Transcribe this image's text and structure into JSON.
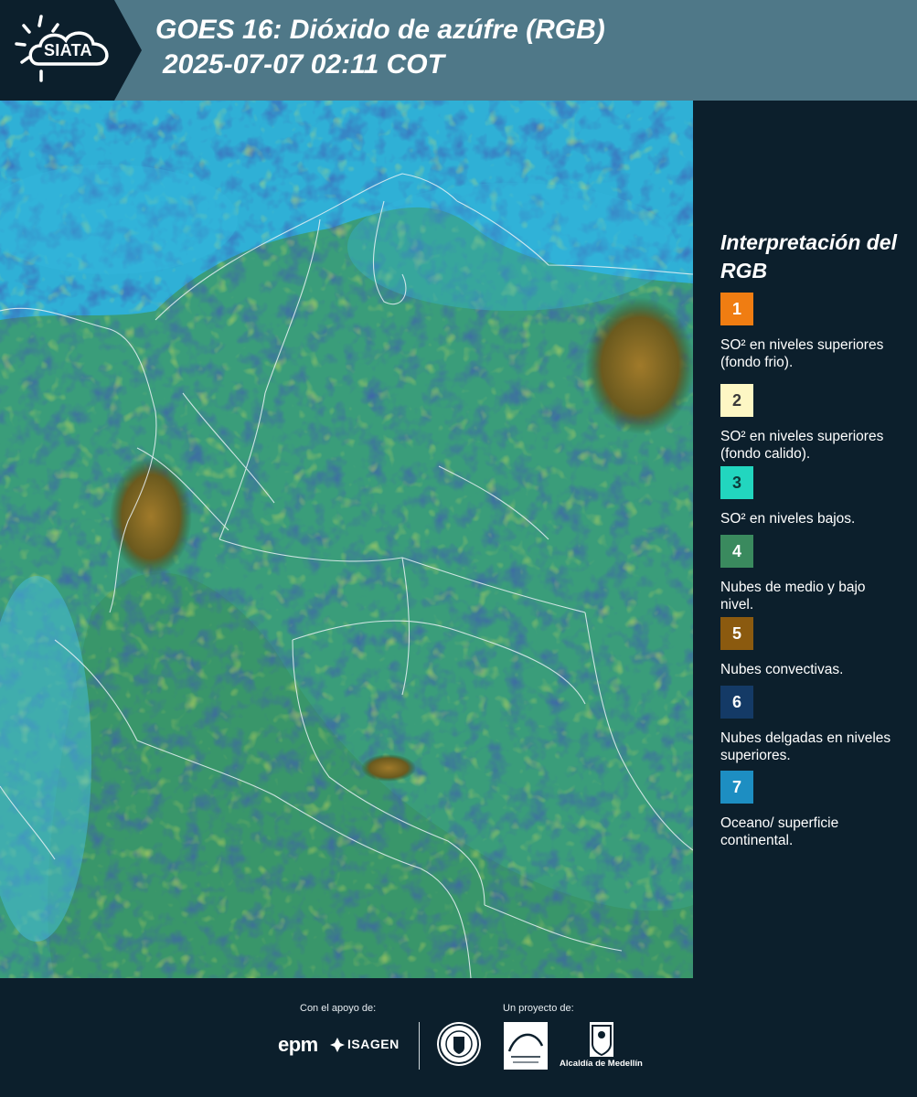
{
  "header": {
    "logo_text": "SIATA",
    "title": "GOES 16: Dióxido de azúfre (RGB)",
    "subtitle": "2025-07-07 02:11 COT"
  },
  "legend": {
    "title": "Interpretación del RGB",
    "items": [
      {
        "number": "1",
        "label": "SO² en niveles superiores (fondo frio).",
        "color": "#f07d12",
        "text_color": "#ffffff"
      },
      {
        "number": "2",
        "label": "SO² en niveles superiores (fondo calido).",
        "color": "#fdf7c4",
        "text_color": "#3a3a3a"
      },
      {
        "number": "3",
        "label": "SO² en niveles bajos.",
        "color": "#22d6bf",
        "text_color": "#0c3b3b"
      },
      {
        "number": "4",
        "label": "Nubes de medio y bajo nivel.",
        "color": "#3a8a5e",
        "text_color": "#ffffff"
      },
      {
        "number": "5",
        "label": "Nubes convectivas.",
        "color": "#8b5a0f",
        "text_color": "#ffffff"
      },
      {
        "number": "6",
        "label": "Nubes delgadas en niveles superiores.",
        "color": "#143a66",
        "text_color": "#ffffff"
      },
      {
        "number": "7",
        "label": "Oceano/ superficie continental.",
        "color": "#1d8ec2",
        "text_color": "#ffffff"
      }
    ]
  },
  "footer": {
    "support_label": "Con el apoyo de:",
    "project_label": "Un proyecto de:",
    "sponsor_epm": "epm",
    "sponsor_isagen": "ISAGEN",
    "alcaldia": "Alcaldía de Medellín"
  },
  "colors": {
    "header_bg": "#4f7888",
    "panel_bg": "#0c1f2c",
    "ocean": "#2fb0d6",
    "land_green": "#3c9a6a",
    "convective": "#8b6a1e"
  }
}
